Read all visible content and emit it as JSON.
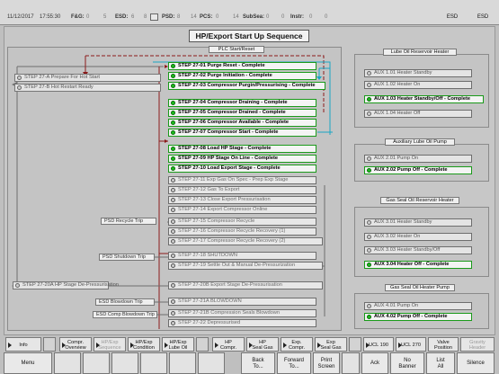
{
  "status": {
    "date": "11/12/2017",
    "time": "17:55:30",
    "fg_label": "F&G:",
    "fg_count_a": "0",
    "fg_count_b": "5",
    "esd_label": "ESD:",
    "esd_count_a": "6",
    "esd_count_b": "8",
    "psd_label": "PSD:",
    "psd_count_a": "8",
    "psd_count_b": "14",
    "pcs_label": "PCS:",
    "pcs_count_a": "0",
    "pcs_count_b": "14",
    "subsea_label": "SubSea:",
    "subsea_count_a": "0",
    "subsea_count_b": "0",
    "instr_label": "Instr:",
    "instr_count_a": "0",
    "instr_count_b": "0",
    "esd_button": "ESD",
    "esd_button_2": "ESD"
  },
  "title": "HP/Export Start Up Sequence",
  "plc_header": "PLC Start/Reset",
  "steps": [
    {
      "label": "STEP 27-01  Purge Reset - Complete",
      "done": true
    },
    {
      "label": "STEP 27-02  Purge Initiation - Complete",
      "done": true
    },
    {
      "label": "STEP 27-03  Compressor Purgin/Pressurising - Complete",
      "done": true
    },
    {
      "label": "STEP 27-04  Compressor Draining - Complete",
      "done": true
    },
    {
      "label": "STEP 27-05  Compressor Drained - Complete",
      "done": true
    },
    {
      "label": "STEP 27-06  Compressor Available - Complete",
      "done": true
    },
    {
      "label": "STEP 27-07  Compressor Start - Complete",
      "done": true
    },
    {
      "label": "STEP 27-08  Load HP Stage - Complete",
      "done": true
    },
    {
      "label": "STEP 27-09  HP Stage On Line - Complete",
      "done": true
    },
    {
      "label": "STEP 27-10  Load Export Stage - Complete",
      "done": true
    },
    {
      "label": "STEP 27-11  Exp Gas On Spec - Prep Exp Stage",
      "done": false
    },
    {
      "label": "STEP 27-12  Gas To Export",
      "done": false
    },
    {
      "label": "STEP 27-13  Close Export Pressurisation",
      "done": false
    },
    {
      "label": "STEP 27-14  Export Compressor Online",
      "done": false
    },
    {
      "label": "STEP 27-15  Compressor Recycle",
      "done": false
    },
    {
      "label": "STEP 27-16  Compressor Recycle Recovery (1)",
      "done": false
    },
    {
      "label": "STEP 27-17  Compressor Recycle Recovery (2)",
      "done": false
    },
    {
      "label": "STEP 27-18  SHUTDOWN",
      "done": false
    },
    {
      "label": "STEP 27-19  Settle Out & Manual De-Pressurization",
      "done": false
    },
    {
      "label": "STEP 27-20B Export Stage De-Pressurisation",
      "done": false
    },
    {
      "label": "STEP 27-21A BLOWDOWN",
      "done": false
    },
    {
      "label": "STEP 27-21B Compression Seals Blowdown",
      "done": false
    },
    {
      "label": "STEP 27-22  Depressurised",
      "done": false
    }
  ],
  "side_steps": {
    "a": "STEP 27-A   Prepare For Hot Start",
    "b": "STEP 27-B   Hot Restart Ready",
    "c": "STEP 27-20A HP Stage De-Pressurisation"
  },
  "trips": {
    "psd_recycle": "PSD Recycle Trip",
    "psd_shutdown": "PSD Shutdown Trip",
    "esd_blowdown": "ESD Blowdown Trip",
    "esd_comp_blowdown": "ESD Comp Blowdown Trip"
  },
  "aux_groups": [
    {
      "header": "Lube Oil Reservoir Heater",
      "items": [
        {
          "label": "AUX 1.01  Heater Standby",
          "done": false
        },
        {
          "label": "AUX 1.02  Heater On",
          "done": false
        },
        {
          "label": "AUX 1.03  Heater Standby/Off - Complete",
          "done": true
        },
        {
          "label": "AUX 1.04  Heater Off",
          "done": false
        }
      ]
    },
    {
      "header": "Auxiliary Lube Oil Pump",
      "items": [
        {
          "label": "AUX 2.01  Pump On",
          "done": false
        },
        {
          "label": "AUX 2.02  Pump Off - Complete",
          "done": true
        }
      ]
    },
    {
      "header": "Gas Seal Oil Reservoir Heater",
      "items": [
        {
          "label": "AUX 3.01  Heater Standby",
          "done": false
        },
        {
          "label": "AUX 3.02  Heater On",
          "done": false
        },
        {
          "label": "AUX 3.03  Heater Standby/Off",
          "done": false
        },
        {
          "label": "AUX 3.04  Heater Off - Complete",
          "done": true
        }
      ]
    },
    {
      "header": "Gas Seal Oil Heater Pump",
      "items": [
        {
          "label": "AUX 4.01  Pump On",
          "done": false
        },
        {
          "label": "AUX 4.02  Pump Off - Complete",
          "done": true
        }
      ]
    }
  ],
  "nav": {
    "info": "Info",
    "compr_overview": "Compr.\nOverview",
    "hp_exp_sequence": "HP/Exp\nSequence",
    "hp_exp_condition": "HP/Exp\nCondition",
    "hp_exp_lube_oil": "HP/Exp\nLube Oil",
    "hp_compr": "HP\nCompr.",
    "hp_seal_gas": "HP\nSeal Gas",
    "exp_compr": "Exp.\nCompr.",
    "exp_seal_gas": "Exp\nSeal Gas",
    "ucl190": "UCL 190",
    "ucl270": "UCL 270",
    "valve_position": "Valve\nPosition",
    "gravity_header": "Gravity\nHeader"
  },
  "fkeys": {
    "menu": "Menu",
    "back": "Back\nTo...",
    "forward": "Forward\nTo...",
    "print": "Print\nScreen",
    "ack": "Ack",
    "no_banner": "No\nBanner",
    "list_all": "List\nAll",
    "silence": "Silence"
  },
  "colors": {
    "complete": "#1a9a1a",
    "flow_red": "#8b1a1a",
    "flow_cyan": "#1aa6c4",
    "flow_gray": "#6e6e6e"
  }
}
